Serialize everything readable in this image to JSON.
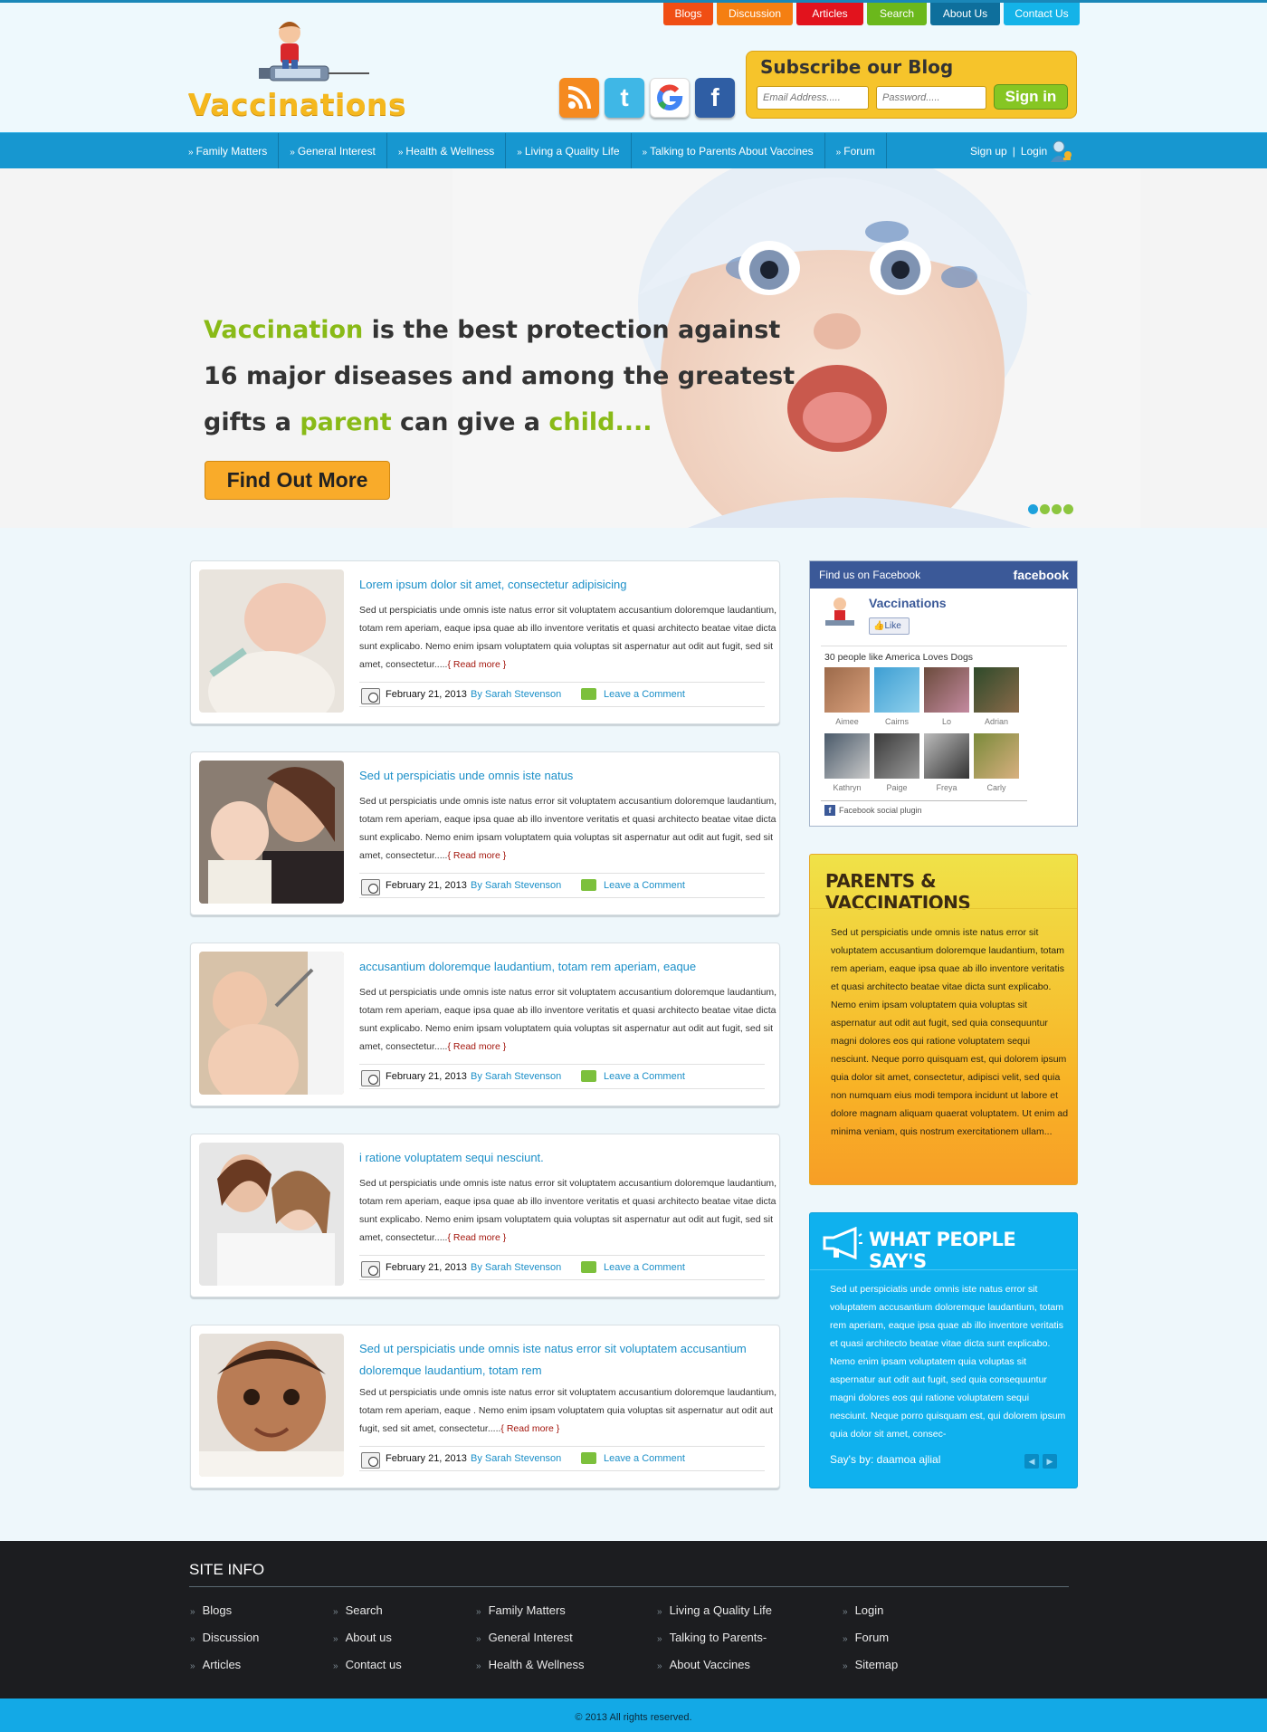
{
  "header": {
    "top_tabs": [
      "Blogs",
      "Discussion",
      "Articles",
      "Search",
      "About Us",
      "Contact Us"
    ],
    "logo_text": "Vaccinations",
    "subscribe": {
      "title": "Subscribe our Blog",
      "email_placeholder": "Email Address.....",
      "password_placeholder": "Password.....",
      "signin_label": "Sign in"
    }
  },
  "nav": {
    "items": [
      "Family Matters",
      "General Interest",
      "Health & Wellness",
      "Living a Quality Life",
      "Talking to Parents About Vaccines",
      "Forum"
    ],
    "signup": "Sign up",
    "separator": "|",
    "login": "Login"
  },
  "hero": {
    "line1_a": "Vaccination",
    "line1_b": " is the best protection against",
    "line2": "16 major diseases and among the greatest",
    "line3_a": "gifts a ",
    "line3_b": "parent",
    "line3_c": " can give a ",
    "line3_d": "child....",
    "button": "Find Out More"
  },
  "posts": [
    {
      "title": "Lorem ipsum dolor sit amet, consectetur adipisicing",
      "body": "Sed ut perspiciatis unde omnis iste natus error sit voluptatem accusantium doloremque laudantium, totam rem aperiam, eaque ipsa quae ab illo inventore veritatis et quasi architecto beatae vitae dicta sunt explicabo. Nemo enim ipsam voluptatem quia voluptas sit aspernatur aut odit aut fugit, sed   sit amet, consectetur.....",
      "read_more": "{ Read more }",
      "date": "February 21, 2013",
      "author": "By Sarah Stevenson",
      "comment": "Leave a Comment"
    },
    {
      "title": "Sed ut perspiciatis unde omnis iste natus",
      "body": "Sed ut perspiciatis unde omnis iste natus error sit voluptatem accusantium doloremque laudantium, totam rem aperiam, eaque ipsa quae ab illo inventore veritatis et quasi architecto beatae vitae dicta sunt explicabo. Nemo enim ipsam voluptatem quia voluptas sit aspernatur aut odit aut fugit, sed   sit amet, consectetur.....",
      "read_more": "{ Read more }",
      "date": "February 21, 2013",
      "author": "By Sarah Stevenson",
      "comment": "Leave a Comment"
    },
    {
      "title": "accusantium doloremque laudantium, totam rem aperiam, eaque",
      "body": "Sed ut perspiciatis unde omnis iste natus error sit voluptatem accusantium doloremque laudantium, totam rem aperiam, eaque ipsa quae ab illo inventore veritatis et quasi architecto beatae vitae dicta sunt explicabo. Nemo enim ipsam voluptatem quia voluptas sit aspernatur aut odit aut fugit, sed   sit amet, consectetur.....",
      "read_more": "{ Read more }",
      "date": "February 21, 2013",
      "author": "By Sarah Stevenson",
      "comment": "Leave a Comment"
    },
    {
      "title": "i ratione voluptatem sequi nesciunt.",
      "body": "Sed ut perspiciatis unde omnis iste natus error sit voluptatem accusantium doloremque laudantium, totam rem aperiam, eaque ipsa quae ab illo inventore veritatis et quasi architecto beatae vitae dicta sunt explicabo. Nemo enim ipsam voluptatem quia voluptas sit aspernatur aut odit aut fugit, sed   sit amet, consectetur.....",
      "read_more": "{ Read more }",
      "date": "February 21, 2013",
      "author": "By Sarah Stevenson",
      "comment": "Leave a Comment"
    },
    {
      "title": "Sed ut perspiciatis unde omnis iste natus error sit voluptatem accusantium doloremque laudantium, totam rem",
      "body": "Sed ut perspiciatis unde omnis iste natus error sit voluptatem accusantium doloremque laudantium, totam rem aperiam, eaque . Nemo enim ipsam voluptatem quia voluptas sit aspernatur aut odit aut fugit, sed   sit amet, consectetur.....",
      "read_more": "{ Read more }",
      "date": "February 21, 2013",
      "author": "By Sarah Stevenson",
      "comment": "Leave a Comment"
    }
  ],
  "facebook": {
    "header": "Find us on Facebook",
    "brand": "facebook",
    "page_name": "Vaccinations",
    "like": "Like",
    "count_text": "30 people like",
    "count_page": "America Loves Dogs",
    "faces": [
      "Aimee",
      "Cairns",
      "Lo",
      "Adrian",
      "Kathryn",
      "Paige",
      "Freya",
      "Carly"
    ],
    "footer": "Facebook social plugin"
  },
  "parents": {
    "title": "PARENTS & VACCINATIONS",
    "body": "Sed ut perspiciatis unde omnis iste natus error sit voluptatem accusantium doloremque laudantium, totam rem aperiam, eaque ipsa quae ab illo inventore veritatis et quasi architecto beatae vitae dicta sunt explicabo. Nemo enim ipsam voluptatem quia voluptas sit aspernatur aut odit aut fugit, sed quia consequuntur magni dolores eos qui ratione voluptatem sequi nesciunt. Neque porro quisquam est, qui dolorem ipsum quia dolor sit amet, consectetur, adipisci velit, sed quia non numquam eius modi tempora incidunt ut labore et dolore magnam aliquam quaerat voluptatem. Ut enim ad minima veniam, quis nostrum exercitationem ullam..."
  },
  "testimonials": {
    "title": "WHAT PEOPLE SAY'S",
    "body": "Sed ut perspiciatis unde omnis iste natus error sit voluptatem accusantium doloremque laudantium, totam rem aperiam, eaque ipsa quae ab illo inventore veritatis et quasi architecto beatae vitae dicta sunt explicabo. Nemo enim ipsam voluptatem quia voluptas sit aspernatur aut odit aut fugit, sed quia consequuntur magni dolores eos qui ratione voluptatem sequi nesciunt. Neque porro quisquam est, qui dolorem ipsum quia dolor sit amet, consec-",
    "says_by": "Say's by:  daamoa ajlial"
  },
  "footer": {
    "title": "SITE INFO",
    "columns": [
      [
        "Blogs",
        "Discussion",
        "Articles"
      ],
      [
        "Search",
        "About us",
        "Contact us"
      ],
      [
        "Family Matters",
        "General Interest",
        "Health & Wellness"
      ],
      [
        "Living a Quality Life",
        "Talking to Parents-",
        "About Vaccines"
      ],
      [
        "Login",
        "Forum",
        "Sitemap"
      ]
    ],
    "copyright": "© 2013 All rights reserved."
  }
}
